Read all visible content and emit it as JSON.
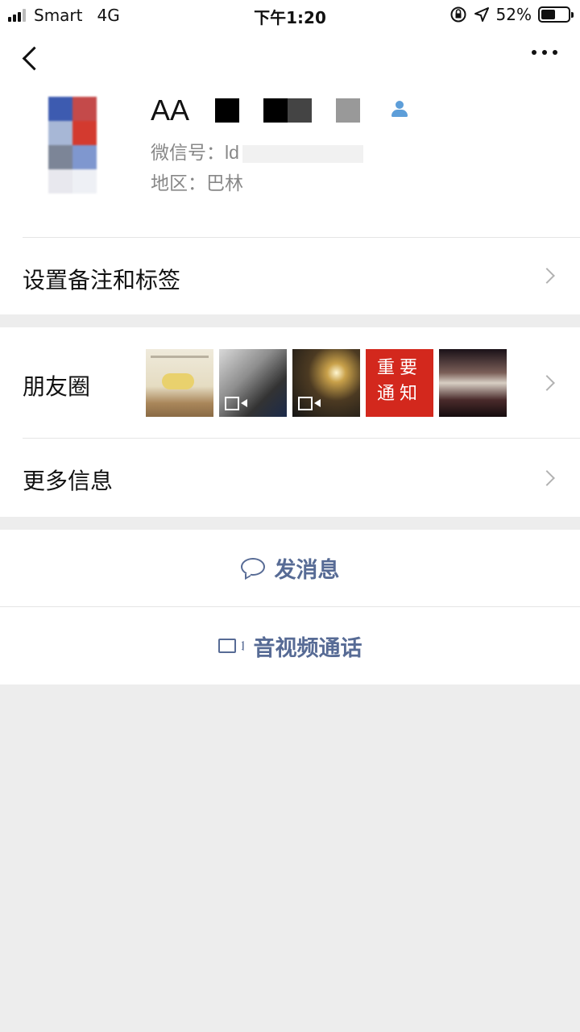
{
  "status_bar": {
    "carrier": "Smart",
    "network": "4G",
    "time": "下午1:20",
    "battery_percent": "52%",
    "battery_level": 0.52
  },
  "nav": {
    "back_icon": "chevron-left-icon",
    "more_icon": "more-dots-icon"
  },
  "profile": {
    "name_visible": "AA",
    "wechat_id_label": "微信号：",
    "wechat_id_value": "ld",
    "region_label": "地区：",
    "region_value": "巴林"
  },
  "rows": {
    "remark": "设置备注和标签",
    "moments": "朋友圈",
    "more_info": "更多信息"
  },
  "moments_thumbs": {
    "notice_line1": "重要",
    "notice_line2": "通知"
  },
  "actions": {
    "send_message": "发消息",
    "video_call": "音视频通话"
  },
  "colors": {
    "link_blue": "#576b95",
    "background": "#ededed"
  }
}
